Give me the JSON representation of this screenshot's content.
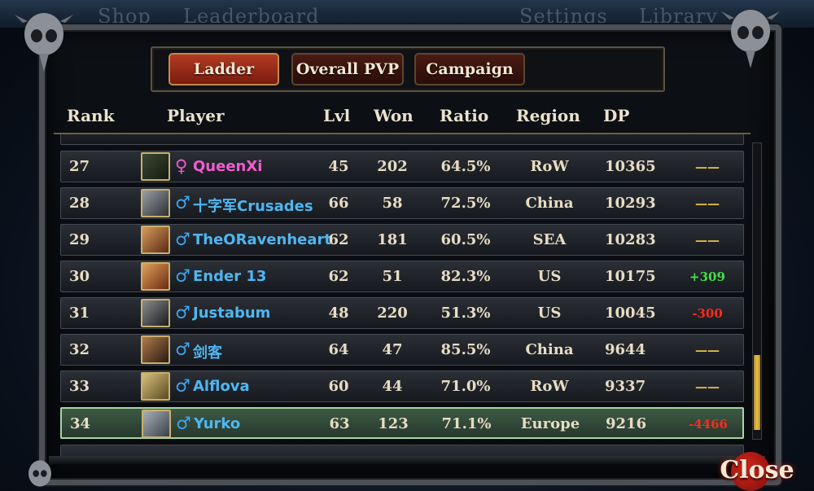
{
  "top_nav": [
    "Shop",
    "Leaderboard",
    "Settings",
    "Library"
  ],
  "tabs": [
    {
      "label": "Ladder",
      "active": true
    },
    {
      "label": "Overall PVP",
      "active": false
    },
    {
      "label": "Campaign",
      "active": false
    }
  ],
  "columns": {
    "rank": "Rank",
    "player": "Player",
    "lvl": "Lvl",
    "won": "Won",
    "ratio": "Ratio",
    "region": "Region",
    "dp": "DP"
  },
  "rows": [
    {
      "rank": "27",
      "gender": "♀",
      "gender_type": "female",
      "player": "QueenXi",
      "lvl": "45",
      "won": "202",
      "ratio": "64.5%",
      "region": "RoW",
      "dp": "10365",
      "delta": "——",
      "delta_type": "dash"
    },
    {
      "rank": "28",
      "gender": "♂",
      "gender_type": "male",
      "player": "十字军Crusades",
      "lvl": "66",
      "won": "58",
      "ratio": "72.5%",
      "region": "China",
      "dp": "10293",
      "delta": "——",
      "delta_type": "dash"
    },
    {
      "rank": "29",
      "gender": "♂",
      "gender_type": "male",
      "player": "TheORavenheart",
      "lvl": "62",
      "won": "181",
      "ratio": "60.5%",
      "region": "SEA",
      "dp": "10283",
      "delta": "——",
      "delta_type": "dash"
    },
    {
      "rank": "30",
      "gender": "♂",
      "gender_type": "male",
      "player": "Ender 13",
      "lvl": "62",
      "won": "51",
      "ratio": "82.3%",
      "region": "US",
      "dp": "10175",
      "delta": "+309",
      "delta_type": "pos"
    },
    {
      "rank": "31",
      "gender": "♂",
      "gender_type": "male",
      "player": "Justabum",
      "lvl": "48",
      "won": "220",
      "ratio": "51.3%",
      "region": "US",
      "dp": "10045",
      "delta": "-300",
      "delta_type": "neg"
    },
    {
      "rank": "32",
      "gender": "♂",
      "gender_type": "male",
      "player": "剑客",
      "lvl": "64",
      "won": "47",
      "ratio": "85.5%",
      "region": "China",
      "dp": "9644",
      "delta": "——",
      "delta_type": "dash"
    },
    {
      "rank": "33",
      "gender": "♂",
      "gender_type": "male",
      "player": "Alflova",
      "lvl": "60",
      "won": "44",
      "ratio": "71.0%",
      "region": "RoW",
      "dp": "9337",
      "delta": "——",
      "delta_type": "dash"
    },
    {
      "rank": "34",
      "gender": "♂",
      "gender_type": "male",
      "player": "Yurko",
      "lvl": "63",
      "won": "123",
      "ratio": "71.1%",
      "region": "Europe",
      "dp": "9216",
      "delta": "-4466",
      "delta_type": "neg",
      "highlighted": true
    }
  ],
  "close_label": "Close",
  "colors": {
    "male_name": "#4fb6f0",
    "female_name": "#f05cd0",
    "delta_positive": "#44e04a",
    "delta_negative": "#ff2a1c",
    "delta_neutral": "#e7c24a",
    "highlight_row": "#3d5a46",
    "active_tab": "#b33a22"
  }
}
